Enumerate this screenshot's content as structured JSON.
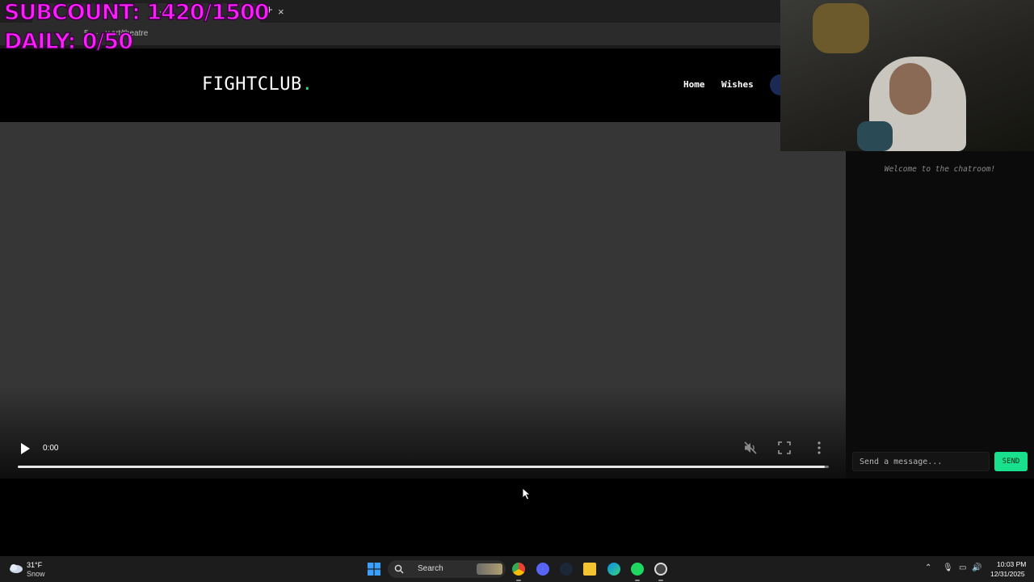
{
  "browser": {
    "tab_title": "· · ·",
    "tab_close": "×",
    "new_tab": "+",
    "url": "5 · · · y.art/theatre"
  },
  "overlay": {
    "subcount": "SUBCOUNT: 1420/1500",
    "daily": "DAILY: 0/50"
  },
  "site": {
    "logo_text": "FIGHTCLUB",
    "logo_dot": ".",
    "nav": {
      "home": "Home",
      "wishes": "Wishes"
    }
  },
  "video": {
    "time": "0:00",
    "progress": 0.995,
    "muted": true
  },
  "chat": {
    "welcome": "Welcome to the chatroom!",
    "input_placeholder": "Send a message...",
    "send_label": "SEND"
  },
  "taskbar": {
    "weather_temp": "31°F",
    "weather_condition": "Snow",
    "search_label": "Search",
    "clock_time": "10:03 PM",
    "clock_date": "12/31/2025",
    "apps": [
      "chrome",
      "discord",
      "steam",
      "file-explorer",
      "edge",
      "spotify",
      "obs"
    ]
  },
  "colors": {
    "accent": "#19e08c",
    "overlay": "#ff1cff",
    "video_bg": "#363636"
  }
}
